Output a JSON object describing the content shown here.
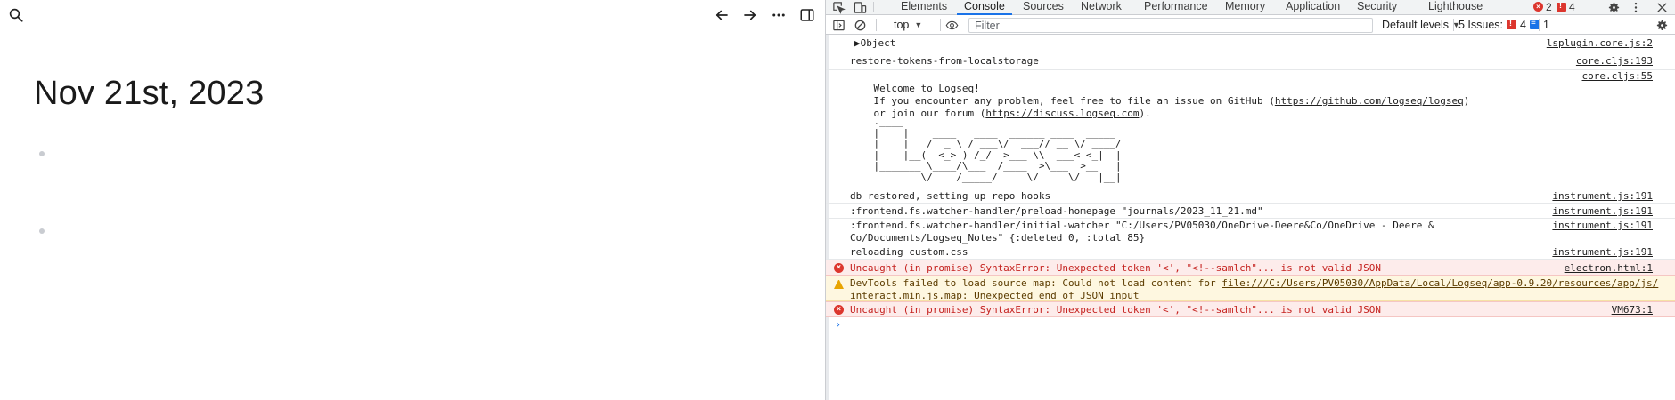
{
  "app": {
    "page_title": "Nov 21st, 2023",
    "icons": {
      "search": "search-icon",
      "back": "arrow-left-icon",
      "forward": "arrow-right-icon",
      "more": "more-horizontal-icon",
      "sidebar": "toggle-sidebar-icon"
    }
  },
  "devtools": {
    "tabs": [
      "Elements",
      "Console",
      "Sources",
      "Network",
      "Performance",
      "Memory",
      "Application",
      "Security",
      "Lighthouse"
    ],
    "active_tab": "Console",
    "error_count": "2",
    "warning_count": "4",
    "toolbar": {
      "context": "top",
      "filter_placeholder": "Filter",
      "levels": "Default levels",
      "issues_label": "5 Issues:",
      "issues_errors": "4",
      "issues_info": "1"
    },
    "colors": {
      "accent": "#1a73e8",
      "error": "#dc362e",
      "error_bg": "#fdeceb",
      "warning_bg": "#fef7e0"
    },
    "messages": [
      {
        "level": "log",
        "text": "▶Object",
        "source": "lsplugin.core.js:2"
      },
      {
        "level": "log",
        "text": "restore-tokens-from-localstorage",
        "source": "core.cljs:193"
      },
      {
        "level": "log",
        "text": "    Welcome to Logseq!\n    If you encounter any problem, feel free to file an issue on GitHub (",
        "link1": "https://github.com/logseq/logseq",
        "text2": ")\n    or join our forum (",
        "link2": "https://discuss.logseq.com",
        "text3": ").",
        "ascii": "    .____\n    |    |    ____   ____  ______ ____  _____\n    |    |   /  _ \\ / ___\\/  ___// __ \\/ ____/\n    |    |__(  <_> ) /_/  >___ \\\\  ___< <_|  |\n    |_______ \\____/\\___  /____  >\\___  >__   |\n            \\/    /_____/     \\/     \\/   |__|",
        "source": "core.cljs:55"
      },
      {
        "level": "log",
        "text": "db restored, setting up repo hooks",
        "source": "instrument.js:191"
      },
      {
        "level": "log",
        "text": ":frontend.fs.watcher-handler/preload-homepage \"journals/2023_11_21.md\"",
        "source": "instrument.js:191"
      },
      {
        "level": "log",
        "text": ":frontend.fs.watcher-handler/initial-watcher \"C:/Users/PV05030/OneDrive-Deere&Co/OneDrive - Deere &\nCo/Documents/Logseq_Notes\" {:deleted 0, :total 85}",
        "source": "instrument.js:191"
      },
      {
        "level": "log",
        "text": "reloading custom.css",
        "source": "instrument.js:191"
      },
      {
        "level": "error",
        "text": "Uncaught (in promise) SyntaxError: Unexpected token '<', \"<!--samlch\"... is not valid JSON",
        "source": "electron.html:1"
      },
      {
        "level": "warning",
        "text": "DevTools failed to load source map: Could not load content for ",
        "link1": "file:///C:/Users/PV05030/AppData/Local/Logseq/app-0.9.20/resources/app/js/",
        "link2": "interact.min.js.map",
        "text2": ": Unexpected end of JSON input"
      },
      {
        "level": "error",
        "text": "Uncaught (in promise) SyntaxError: Unexpected token '<', \"<!--samlch\"... is not valid JSON",
        "source": "VM673:1"
      }
    ],
    "prompt": "›"
  }
}
